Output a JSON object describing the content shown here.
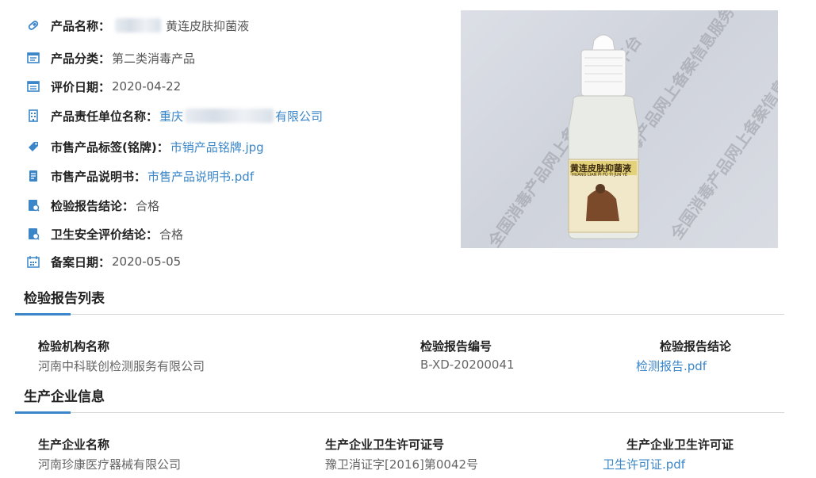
{
  "product": {
    "name_label": "产品名称：",
    "name_value": "黄连皮肤抑菌液",
    "category_label": "产品分类：",
    "category_value": "第二类消毒产品",
    "eval_date_label": "评价日期：",
    "eval_date_value": "2020-04-22",
    "responsible_label": "产品责任单位名称：",
    "responsible_prefix": "重庆",
    "responsible_suffix": "有限公司",
    "tag_label": "市售产品标签(铭牌)：",
    "tag_link": "市销产品铭牌.jpg",
    "manual_label": "市售产品说明书：",
    "manual_link": "市售产品说明书.pdf",
    "report_conclusion_label": "检验报告结论：",
    "report_conclusion_value": "合格",
    "safety_conclusion_label": "卫生安全评价结论：",
    "safety_conclusion_value": "合格",
    "filing_date_label": "备案日期：",
    "filing_date_value": "2020-05-05"
  },
  "photo": {
    "watermark": "全国消毒产品网上备案信息服务平台",
    "bottle_label": "黄连皮肤抑菌液",
    "bottle_pinyin": "HUANG LIAN PI FU YI JUN YE"
  },
  "report_section": {
    "title": "检验报告列表",
    "headers": [
      "检验机构名称",
      "检验报告编号",
      "检验报告结论"
    ],
    "row": {
      "org": "河南中科联创检测服务有限公司",
      "number": "B-XD-20200041",
      "conclusion_link": "检测报告.pdf"
    }
  },
  "producer_section": {
    "title": "生产企业信息",
    "headers": [
      "生产企业名称",
      "生产企业卫生许可证号",
      "生产企业卫生许可证"
    ],
    "row": {
      "name": "河南珍康医疗器械有限公司",
      "license_no": "豫卫消证字[2016]第0042号",
      "license_link": "卫生许可证.pdf"
    }
  },
  "colors": {
    "accent": "#3a86c8",
    "icon": "#3a86c8"
  },
  "icons": [
    "pill-icon",
    "list-icon",
    "calendar-card-icon",
    "building-icon",
    "tag-icon",
    "document-icon",
    "report-icon",
    "safety-report-icon",
    "calendar-icon"
  ]
}
